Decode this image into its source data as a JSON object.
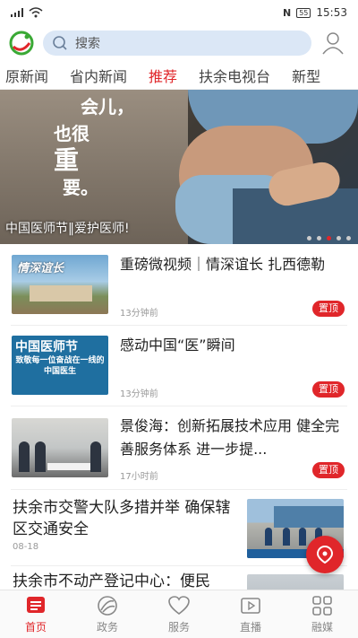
{
  "status_bar": {
    "time": "15:53",
    "battery": "55"
  },
  "search": {
    "placeholder": "搜索"
  },
  "tabs": [
    {
      "label": "原新闻"
    },
    {
      "label": "省内新闻"
    },
    {
      "label": "推荐"
    },
    {
      "label": "扶余电视台"
    },
    {
      "label": "新型"
    }
  ],
  "active_tab": "推荐",
  "banner": {
    "slogan_lines": [
      "会儿，",
      "也很",
      "重",
      "要。"
    ],
    "caption": "中国医师节‖爱护医师!"
  },
  "news": [
    {
      "title": "重磅微视频｜情深谊长 扎西德勒",
      "time": "13分钟前",
      "badge": "置顶",
      "thumb_text": "情深谊长"
    },
    {
      "title": "感动中国“医”瞬间",
      "time": "13分钟前",
      "badge": "置顶",
      "thumb_text_1": "中国医师节",
      "thumb_text_2": "致敬每一位奋战在一线的中国医生"
    },
    {
      "title": "景俊海：创新拓展技术应用 健全完善服务体系 进一步提...",
      "time": "17小时前",
      "badge": "置顶"
    },
    {
      "title": "扶余市交警大队多措并举 确保辖区交通安全",
      "time": "08-18"
    },
    {
      "title": "扶余市不动产登记中心：便民"
    }
  ],
  "bottom_nav": [
    {
      "label": "首页",
      "icon": "home-icon"
    },
    {
      "label": "政务",
      "icon": "gov-icon"
    },
    {
      "label": "服务",
      "icon": "heart-icon"
    },
    {
      "label": "直播",
      "icon": "live-icon"
    },
    {
      "label": "融媒",
      "icon": "grid-icon"
    }
  ],
  "colors": {
    "accent": "#e0262a",
    "search_bg": "#dbe7f6",
    "logo_green": "#3aa935"
  }
}
